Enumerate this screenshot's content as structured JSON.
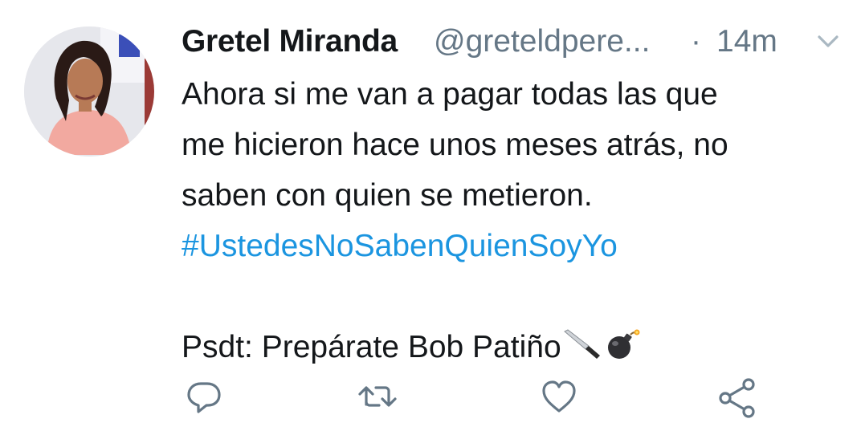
{
  "tweet": {
    "author_name": "Gretel Miranda",
    "author_handle": "@greteldpere...",
    "separator": "·",
    "time": "14m",
    "lines": [
      "Ahora si me van a pagar todas las que",
      "me hicieron hace unos meses atrás, no",
      "saben con quien se metieron."
    ],
    "hashtag": "#UstedesNoSabenQuienSoyYo",
    "psdt": "Psdt: Prepárate Bob Patiño",
    "emojis": [
      "knife-icon",
      "bomb-icon"
    ]
  },
  "actions": [
    "reply-icon",
    "retweet-icon",
    "like-icon",
    "share-icon"
  ],
  "colors": {
    "text": "#14171a",
    "muted": "#657786",
    "hashtag": "#1b95e0",
    "icon": "#657786"
  }
}
